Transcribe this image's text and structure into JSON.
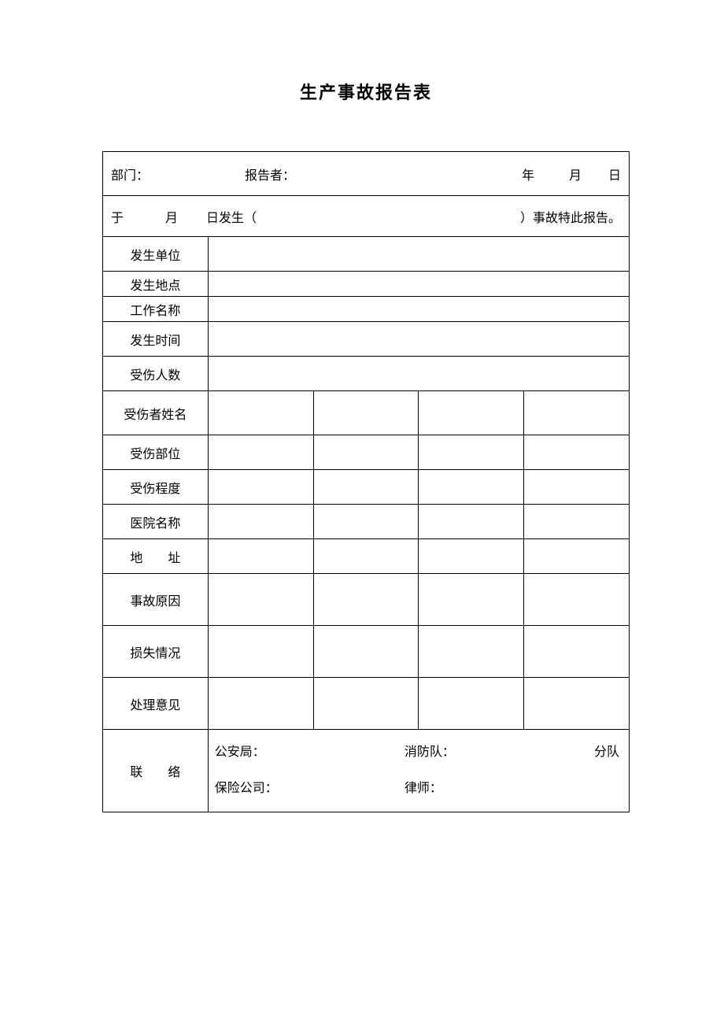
{
  "title": "生产事故报告表",
  "header": {
    "dept_label": "部门：",
    "reporter_label": "报告者：",
    "year_label": "年",
    "month_label": "月",
    "day_label": "日"
  },
  "sentence": {
    "part1": "于",
    "part2": "月",
    "part3": "日发生（",
    "part4": "）事故特此报告。"
  },
  "rows": {
    "unit": "发生单位",
    "location": "发生地点",
    "work_name": "工作名称",
    "time": "发生时间",
    "injured_count": "受伤人数",
    "injured_name": "受伤者姓名",
    "injured_part": "受伤部位",
    "injury_degree": "受伤程度",
    "hospital": "医院名称",
    "address": "地　　址",
    "cause": "事故原因",
    "loss": "损失情况",
    "opinion": "处理意见",
    "contact": "联　　络"
  },
  "contact": {
    "police": "公安局：",
    "fire": "消防队：",
    "squad": "分队",
    "insurance": "保险公司：",
    "lawyer": "律师："
  }
}
